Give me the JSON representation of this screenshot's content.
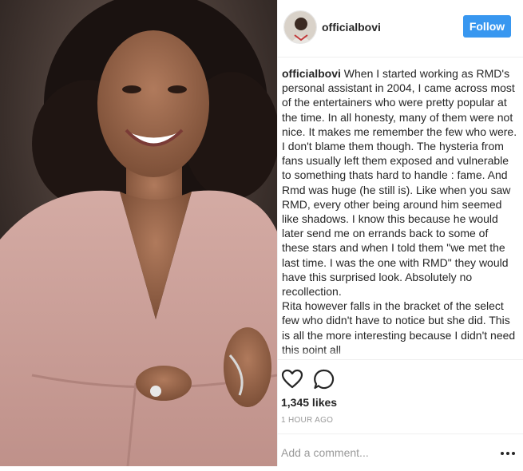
{
  "post": {
    "username": "officialbovi",
    "follow_label": "Follow",
    "caption_user": "officialbovi",
    "caption_text": " When I started working as RMD's personal assistant in 2004, I came across most of the entertainers who were pretty popular at the time. In all honesty, many of them were not nice. It makes me remember the few who were. I don't blame them though. The hysteria from fans usually left them exposed and vulnerable to something thats hard to handle : fame. And Rmd was huge (he still is). Like when you saw RMD, every other being around him seemed like shadows. I know this because he would later send me on errands back to some of these stars and when I told them \"we met the last time. I was the one with RMD\" they would have this surprised look. Absolutely no recollection.\nRita however falls in the bracket of the select few who didn't have to notice but she did. This is all the more interesting because I didn't need this point all",
    "likes": "1,345 likes",
    "time": "1 HOUR AGO",
    "comment_placeholder": "Add a comment...",
    "icons": {
      "like": "heart-icon",
      "comment": "comment-bubble-icon",
      "more": "more-options-icon"
    },
    "colors": {
      "follow_button": "#3897f0",
      "dress": "#c9a09a",
      "background": "#2a2320"
    }
  }
}
